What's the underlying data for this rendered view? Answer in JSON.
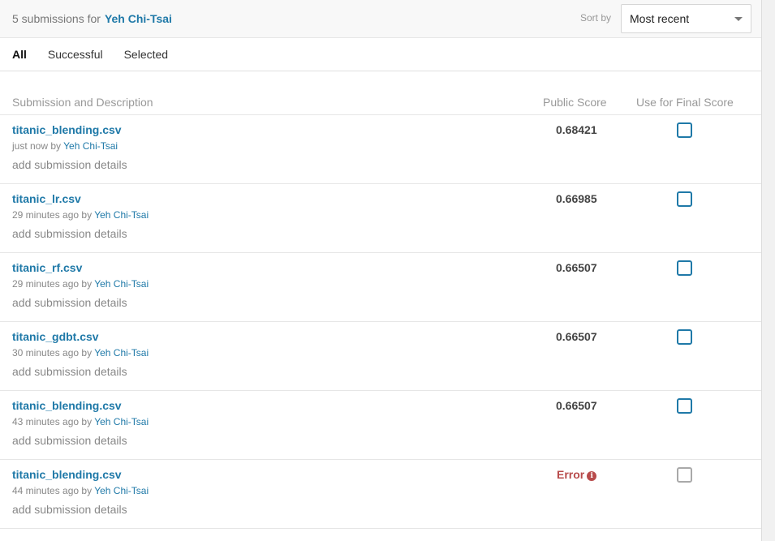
{
  "header": {
    "count_label": "5 submissions for",
    "user": "Yeh Chi-Tsai",
    "sort_label": "Sort by",
    "sort_value": "Most recent"
  },
  "tabs": [
    "All",
    "Successful",
    "Selected"
  ],
  "table": {
    "col_desc": "Submission and Description",
    "col_score": "Public Score",
    "col_final": "Use for Final Score"
  },
  "rows": [
    {
      "file": "titanic_blending.csv",
      "time": "just now by ",
      "user": "Yeh Chi-Tsai",
      "details": "add submission details",
      "score": "0.68421"
    },
    {
      "file": "titanic_lr.csv",
      "time": "29 minutes ago by ",
      "user": "Yeh Chi-Tsai",
      "details": "add submission details",
      "score": "0.66985"
    },
    {
      "file": "titanic_rf.csv",
      "time": "29 minutes ago by ",
      "user": "Yeh Chi-Tsai",
      "details": "add submission details",
      "score": "0.66507"
    },
    {
      "file": "titanic_gdbt.csv",
      "time": "30 minutes ago by ",
      "user": "Yeh Chi-Tsai",
      "details": "add submission details",
      "score": "0.66507"
    },
    {
      "file": "titanic_blending.csv",
      "time": "43 minutes ago by ",
      "user": "Yeh Chi-Tsai",
      "details": "add submission details",
      "score": "0.66507"
    },
    {
      "file": "titanic_blending.csv",
      "time": "44 minutes ago by ",
      "user": "Yeh Chi-Tsai",
      "details": "add submission details",
      "score": "Error"
    }
  ],
  "colors": {
    "link": "#1f79a8",
    "error": "#b84b4b",
    "checkbox_border": "#1f79a8",
    "checkbox_disabled": "#a9a9a9"
  },
  "icons": {
    "error": "info-circle-icon",
    "sort": "chevron-down-icon"
  }
}
